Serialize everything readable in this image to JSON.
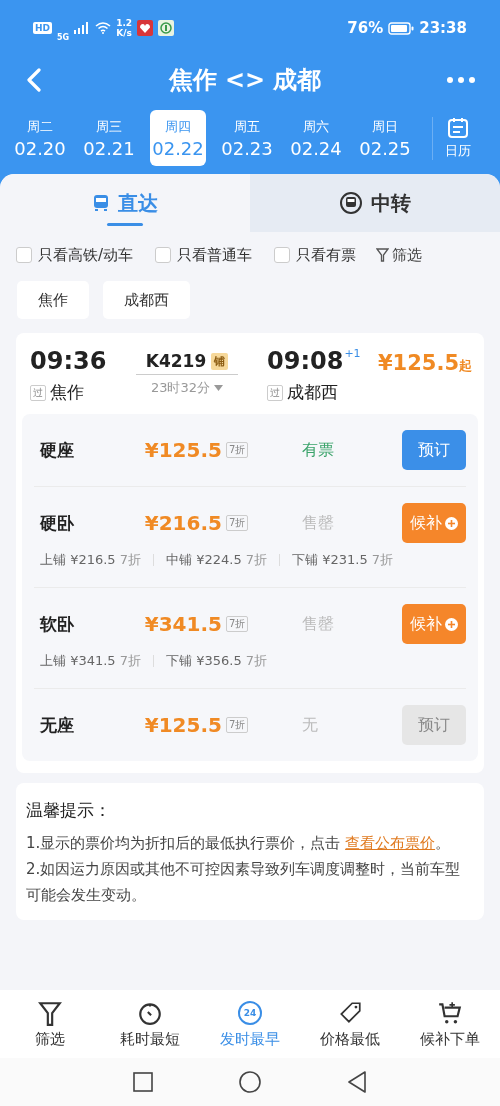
{
  "status_bar": {
    "hd": "HD",
    "network": "5G",
    "speed_value": "1.2",
    "speed_unit": "K/s",
    "battery": "76%",
    "time": "23:38"
  },
  "header": {
    "title": "焦作 <> 成都"
  },
  "dates": [
    {
      "weekday": "周二",
      "date": "02.20",
      "selected": false
    },
    {
      "weekday": "周三",
      "date": "02.21",
      "selected": false
    },
    {
      "weekday": "周四",
      "date": "02.22",
      "selected": true
    },
    {
      "weekday": "周五",
      "date": "02.23",
      "selected": false
    },
    {
      "weekday": "周六",
      "date": "02.24",
      "selected": false
    },
    {
      "weekday": "周日",
      "date": "02.25",
      "selected": false
    }
  ],
  "calendar": {
    "label": "日历"
  },
  "tabs": [
    {
      "label": "直达",
      "selected": true
    },
    {
      "label": "中转",
      "selected": false
    }
  ],
  "filters": [
    {
      "label": "只看高铁/动车",
      "checked": false
    },
    {
      "label": "只看普通车",
      "checked": false
    },
    {
      "label": "只看有票",
      "checked": false
    }
  ],
  "filter_button": {
    "label": "筛选"
  },
  "stations": [
    "焦作",
    "成都西"
  ],
  "train": {
    "depart_time": "09:36",
    "train_no": "K4219",
    "berth_tag": "铺",
    "duration": "23时32分",
    "arrive_time": "09:08",
    "day_offset": "+1",
    "price": "¥125.5",
    "price_suffix": "起",
    "pass_tag_from": "过",
    "from": "焦作",
    "pass_tag_to": "过",
    "to": "成都西",
    "seats": [
      {
        "name": "硬座",
        "price": "¥125.5",
        "discount": "7折",
        "status": "有票",
        "available": true,
        "button": {
          "label": "预订",
          "kind": "book"
        }
      },
      {
        "name": "硬卧",
        "price": "¥216.5",
        "discount": "7折",
        "status": "售罄",
        "available": false,
        "button": {
          "label": "候补",
          "kind": "waitlist"
        },
        "berths": [
          {
            "label": "上铺 ¥216.5",
            "discount": "7折"
          },
          {
            "label": "中铺 ¥224.5",
            "discount": "7折"
          },
          {
            "label": "下铺 ¥231.5",
            "discount": "7折"
          }
        ]
      },
      {
        "name": "软卧",
        "price": "¥341.5",
        "discount": "7折",
        "status": "售罄",
        "available": false,
        "button": {
          "label": "候补",
          "kind": "waitlist"
        },
        "berths": [
          {
            "label": "上铺 ¥341.5",
            "discount": "7折"
          },
          {
            "label": "下铺 ¥356.5",
            "discount": "7折"
          }
        ]
      },
      {
        "name": "无座",
        "price": "¥125.5",
        "discount": "7折",
        "status": "无",
        "available": false,
        "button": {
          "label": "预订",
          "kind": "disabled"
        }
      }
    ]
  },
  "tips": {
    "title": "温馨提示：",
    "items": [
      {
        "text": "1.显示的票价均为折扣后的最低执行票价，点击 ",
        "link": "查看公布票价",
        "after": "。"
      },
      {
        "text": "2.如因运力原因或其他不可控因素导致列车调度调整时，当前车型可能会发生变动。"
      }
    ]
  },
  "bottom_nav": [
    {
      "label": "筛选",
      "kind": "filter",
      "selected": false
    },
    {
      "label": "耗时最短",
      "kind": "timer",
      "selected": false
    },
    {
      "label": "发时最早",
      "kind": "badge",
      "badge": "24",
      "selected": true
    },
    {
      "label": "价格最低",
      "kind": "tag",
      "selected": false
    },
    {
      "label": "候补下单",
      "kind": "cart",
      "selected": false
    }
  ]
}
